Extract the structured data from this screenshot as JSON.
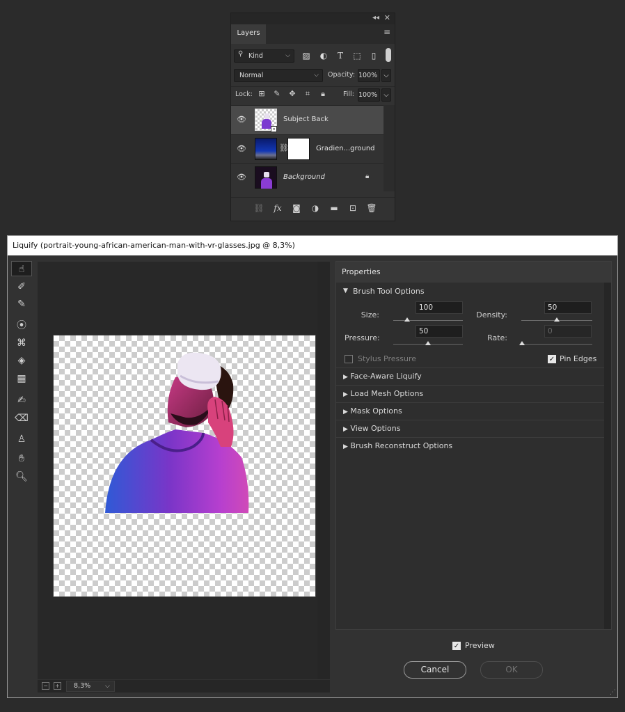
{
  "layers_panel": {
    "tab_label": "Layers",
    "kind_filter": "Kind",
    "blend_mode": "Normal",
    "opacity_label": "Opacity:",
    "opacity_value": "100%",
    "lock_label": "Lock:",
    "fill_label": "Fill:",
    "fill_value": "100%",
    "layers": [
      {
        "name": "Subject Back",
        "selected": true
      },
      {
        "name": "Gradien...ground",
        "selected": false
      },
      {
        "name": "Background",
        "selected": false,
        "locked": true
      }
    ],
    "footer_fx": "fx"
  },
  "dialog": {
    "title": "Liquify (portrait-young-african-american-man-with-vr-glasses.jpg @ 8,3%)",
    "zoom": "8,3%",
    "zoom_minus": "−",
    "zoom_plus": "+",
    "properties": {
      "header": "Properties",
      "brush_tool_options": "Brush Tool Options",
      "size_label": "Size:",
      "size_value": "100",
      "density_label": "Density:",
      "density_value": "50",
      "pressure_label": "Pressure:",
      "pressure_value": "50",
      "rate_label": "Rate:",
      "rate_value": "0",
      "stylus_pressure": "Stylus Pressure",
      "pin_edges": "Pin Edges",
      "sections": [
        "Face-Aware Liquify",
        "Load Mesh Options",
        "Mask Options",
        "View Options",
        "Brush Reconstruct Options"
      ]
    },
    "preview_label": "Preview",
    "cancel_label": "Cancel",
    "ok_label": "OK"
  }
}
